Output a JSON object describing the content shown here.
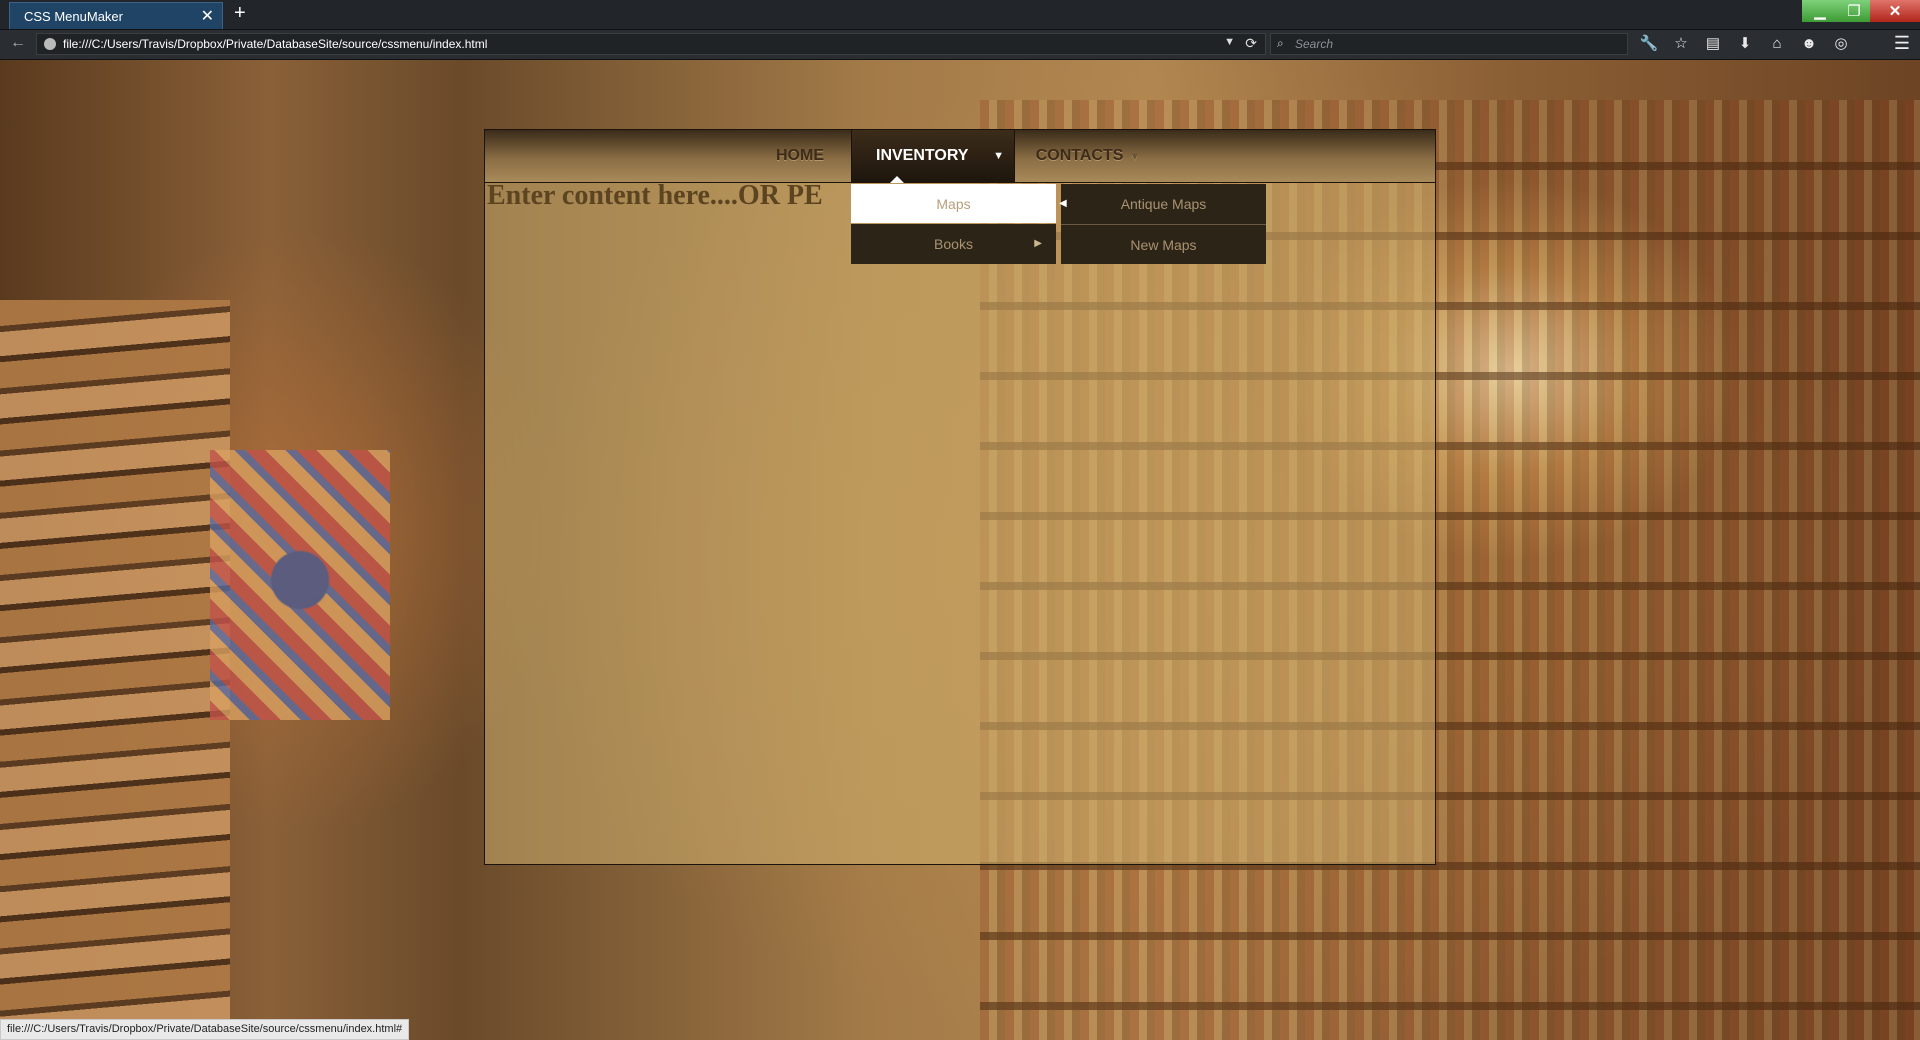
{
  "browser": {
    "tab_title": "CSS MenuMaker",
    "tab_close": "✕",
    "new_tab": "+",
    "window_min": "▁",
    "window_max": "❐",
    "window_close": "✕",
    "back": "←",
    "url": "file:///C:/Users/Travis/Dropbox/Private/DatabaseSite/source/cssmenu/index.html",
    "url_dropdown": "▼",
    "reload": "⟳",
    "search_icon": "⌕",
    "search_placeholder": "Search",
    "toolbar": [
      {
        "name": "wrench-icon",
        "glyph": "🔧"
      },
      {
        "name": "bookmark-star-icon",
        "glyph": "☆"
      },
      {
        "name": "reading-list-icon",
        "glyph": "▤"
      },
      {
        "name": "download-icon",
        "glyph": "⬇"
      },
      {
        "name": "home-icon",
        "glyph": "⌂"
      },
      {
        "name": "chat-icon",
        "glyph": "☻"
      },
      {
        "name": "sync-icon",
        "glyph": "◎"
      }
    ],
    "menu": "☰",
    "status_text": "file:///C:/Users/Travis/Dropbox/Private/DatabaseSite/source/cssmenu/index.html#"
  },
  "page": {
    "menu": {
      "home": "HOME",
      "inventory": "INVENTORY",
      "inventory_caret": "▼",
      "contacts": "CONTACTS",
      "contacts_caret": "▼"
    },
    "content_text": "Enter content here....OR PE",
    "dropdown": {
      "maps": "Maps",
      "books": "Books",
      "books_arrow": "▶",
      "antique_maps": "Antique Maps",
      "antique_arrow": "◀",
      "new_maps": "New Maps"
    }
  }
}
